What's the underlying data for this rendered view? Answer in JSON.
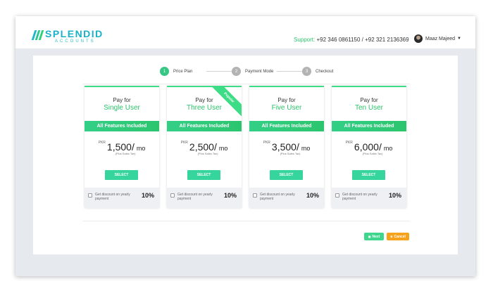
{
  "header": {
    "logo_name": "SPLENDID",
    "logo_sub": "ACCOUNTS",
    "support_label": "Support:",
    "support_numbers": "+92 346 0861150 / +92 321 2136369",
    "user_name": "Maaz Majeed"
  },
  "steps": [
    {
      "num": "1",
      "label": "Price Plan",
      "active": true
    },
    {
      "num": "2",
      "label": "Payment Mode",
      "active": false
    },
    {
      "num": "3",
      "label": "Checkout",
      "active": false
    }
  ],
  "plans": [
    {
      "pay_for": "Pay for",
      "name": "Single User",
      "band": "All Features Included",
      "currency": "PKR",
      "amount": "1,500/",
      "per": "mo",
      "tax": "(Plus Sales Tax)",
      "select": "SELECT",
      "discount_text": "Get discount on yearly payment",
      "discount_pct": "10%"
    },
    {
      "pay_for": "Pay for",
      "name": "Three User",
      "band": "All Features Included",
      "currency": "PKR",
      "amount": "2,500/",
      "per": "mo",
      "tax": "(Plus Sales Tax)",
      "select": "SELECT",
      "discount_text": "Get discount on yearly payment",
      "discount_pct": "10%",
      "ribbon": "Popular"
    },
    {
      "pay_for": "Pay for",
      "name": "Five User",
      "band": "All Features Included",
      "currency": "PKR",
      "amount": "3,500/",
      "per": "mo",
      "tax": "(Plus Sales Tax)",
      "select": "SELECT",
      "discount_text": "Get discount on yearly payment",
      "discount_pct": "10%"
    },
    {
      "pay_for": "Pay for",
      "name": "Ten User",
      "band": "All Features Included",
      "currency": "PKR",
      "amount": "6,000/",
      "per": "mo",
      "tax": "(Plus Sales Tax)",
      "select": "SELECT",
      "discount_text": "Get discount on yearly payment",
      "discount_pct": "10%"
    }
  ],
  "actions": {
    "next_label": "Next",
    "cancel_label": "Cancel"
  },
  "colors": {
    "accent_green": "#2cc36b",
    "cancel_orange": "#f7a21b",
    "logo_blue": "#17b2c7"
  }
}
